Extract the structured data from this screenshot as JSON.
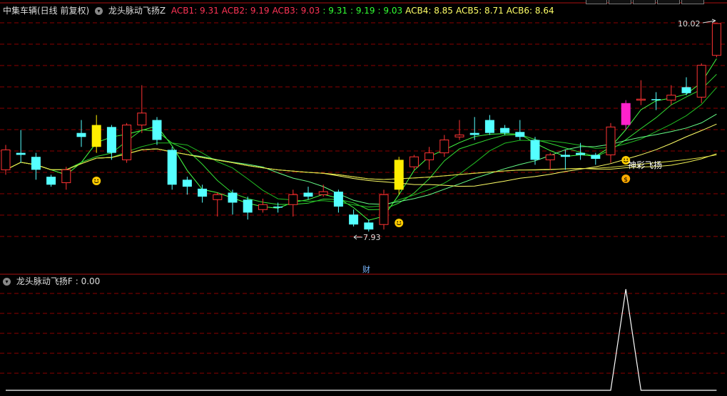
{
  "header": {
    "stock_name": "中集车辆(日线 前复权)",
    "indicator_name": "龙头脉动飞扬Z",
    "acb_lines": [
      {
        "label": "ACB1: 9.31",
        "color": "#ff3355"
      },
      {
        "label": "ACB2: 9.19",
        "color": "#ff3355"
      },
      {
        "label": "ACB3: 9.03",
        "color": "#ff3355"
      },
      {
        "label": ": 9.31",
        "color": "#33ff33"
      },
      {
        "label": ": 9.19",
        "color": "#33ff33"
      },
      {
        "label": ": 9.03",
        "color": "#33ff33"
      },
      {
        "label": "ACB4: 8.85",
        "color": "#ffff66"
      },
      {
        "label": "ACB5: 8.71",
        "color": "#ffff66"
      },
      {
        "label": "ACB6: 8.64",
        "color": "#ffff66"
      }
    ]
  },
  "price_labels": {
    "high": "10.02",
    "low": "7.93",
    "signal": "神彩飞扬"
  },
  "divider_label": "财",
  "sub_indicator": {
    "name": "龙头脉动飞扬F",
    "value": ": 0.00"
  },
  "colors": {
    "up": "#ff3333",
    "down": "#55ffff",
    "yellow": "#ffee00",
    "magenta": "#ff22cc",
    "grid": "#8b0000"
  },
  "chart_data": {
    "type": "candlestick",
    "candles": [
      {
        "o": 8.75,
        "c": 8.55,
        "h": 8.8,
        "l": 8.5,
        "t": "up"
      },
      {
        "o": 8.72,
        "c": 8.7,
        "h": 8.95,
        "l": 8.62,
        "t": "down"
      },
      {
        "o": 8.68,
        "c": 8.55,
        "h": 8.72,
        "l": 8.45,
        "t": "down"
      },
      {
        "o": 8.48,
        "c": 8.4,
        "h": 8.5,
        "l": 8.38,
        "t": "down"
      },
      {
        "o": 8.42,
        "c": 8.55,
        "h": 8.58,
        "l": 8.35,
        "t": "up"
      },
      {
        "o": 8.88,
        "c": 8.92,
        "h": 9.05,
        "l": 8.78,
        "t": "down"
      },
      {
        "o": 8.78,
        "c": 9.0,
        "h": 9.1,
        "l": 8.72,
        "t": "yellow"
      },
      {
        "o": 8.98,
        "c": 8.72,
        "h": 9.0,
        "l": 8.65,
        "t": "down"
      },
      {
        "o": 8.65,
        "c": 9.0,
        "h": 9.02,
        "l": 8.62,
        "t": "up"
      },
      {
        "o": 9.0,
        "c": 9.12,
        "h": 9.4,
        "l": 8.92,
        "t": "up"
      },
      {
        "o": 9.05,
        "c": 8.85,
        "h": 9.08,
        "l": 8.8,
        "t": "down"
      },
      {
        "o": 8.75,
        "c": 8.4,
        "h": 8.78,
        "l": 8.35,
        "t": "down"
      },
      {
        "o": 8.45,
        "c": 8.38,
        "h": 8.48,
        "l": 8.3,
        "t": "down"
      },
      {
        "o": 8.36,
        "c": 8.28,
        "h": 8.4,
        "l": 8.22,
        "t": "down"
      },
      {
        "o": 8.25,
        "c": 8.3,
        "h": 8.32,
        "l": 8.08,
        "t": "up"
      },
      {
        "o": 8.32,
        "c": 8.22,
        "h": 8.35,
        "l": 8.1,
        "t": "down"
      },
      {
        "o": 8.25,
        "c": 8.12,
        "h": 8.28,
        "l": 8.05,
        "t": "down"
      },
      {
        "o": 8.15,
        "c": 8.2,
        "h": 8.26,
        "l": 8.12,
        "t": "up"
      },
      {
        "o": 8.18,
        "c": 8.17,
        "h": 8.22,
        "l": 8.12,
        "t": "down"
      },
      {
        "o": 8.2,
        "c": 8.3,
        "h": 8.35,
        "l": 8.08,
        "t": "up"
      },
      {
        "o": 8.32,
        "c": 8.28,
        "h": 8.38,
        "l": 8.25,
        "t": "down"
      },
      {
        "o": 8.3,
        "c": 8.33,
        "h": 8.4,
        "l": 8.28,
        "t": "up"
      },
      {
        "o": 8.33,
        "c": 8.18,
        "h": 8.35,
        "l": 8.12,
        "t": "down"
      },
      {
        "o": 8.1,
        "c": 8.0,
        "h": 8.15,
        "l": 7.98,
        "t": "down"
      },
      {
        "o": 8.02,
        "c": 7.95,
        "h": 8.05,
        "l": 7.93,
        "t": "down"
      },
      {
        "o": 8.0,
        "c": 8.3,
        "h": 8.35,
        "l": 7.95,
        "t": "up"
      },
      {
        "o": 8.35,
        "c": 8.65,
        "h": 8.68,
        "l": 8.3,
        "t": "yellow"
      },
      {
        "o": 8.58,
        "c": 8.68,
        "h": 8.7,
        "l": 8.55,
        "t": "up"
      },
      {
        "o": 8.65,
        "c": 8.72,
        "h": 8.78,
        "l": 8.55,
        "t": "up"
      },
      {
        "o": 8.72,
        "c": 8.85,
        "h": 8.9,
        "l": 8.68,
        "t": "up"
      },
      {
        "o": 8.88,
        "c": 8.9,
        "h": 9.05,
        "l": 8.85,
        "t": "up"
      },
      {
        "o": 8.92,
        "c": 8.9,
        "h": 9.08,
        "l": 8.85,
        "t": "down"
      },
      {
        "o": 9.05,
        "c": 8.92,
        "h": 9.1,
        "l": 8.9,
        "t": "down"
      },
      {
        "o": 8.97,
        "c": 8.92,
        "h": 9.0,
        "l": 8.9,
        "t": "down"
      },
      {
        "o": 8.93,
        "c": 8.88,
        "h": 9.05,
        "l": 8.85,
        "t": "down"
      },
      {
        "o": 8.85,
        "c": 8.65,
        "h": 8.88,
        "l": 8.6,
        "t": "down"
      },
      {
        "o": 8.65,
        "c": 8.7,
        "h": 8.72,
        "l": 8.55,
        "t": "up"
      },
      {
        "o": 8.68,
        "c": 8.7,
        "h": 8.75,
        "l": 8.55,
        "t": "down"
      },
      {
        "o": 8.72,
        "c": 8.7,
        "h": 8.82,
        "l": 8.65,
        "t": "down"
      },
      {
        "o": 8.7,
        "c": 8.66,
        "h": 8.72,
        "l": 8.6,
        "t": "down"
      },
      {
        "o": 8.7,
        "c": 8.98,
        "h": 9.02,
        "l": 8.62,
        "t": "up"
      },
      {
        "o": 9.0,
        "c": 9.22,
        "h": 9.25,
        "l": 8.95,
        "t": "magenta"
      },
      {
        "o": 9.25,
        "c": 9.26,
        "h": 9.45,
        "l": 9.2,
        "t": "up"
      },
      {
        "o": 9.26,
        "c": 9.25,
        "h": 9.33,
        "l": 9.15,
        "t": "down"
      },
      {
        "o": 9.25,
        "c": 9.3,
        "h": 9.4,
        "l": 9.2,
        "t": "up"
      },
      {
        "o": 9.32,
        "c": 9.38,
        "h": 9.48,
        "l": 9.3,
        "t": "down"
      },
      {
        "o": 9.28,
        "c": 9.6,
        "h": 9.62,
        "l": 9.22,
        "t": "up"
      },
      {
        "o": 9.7,
        "c": 10.02,
        "h": 10.02,
        "l": 9.68,
        "t": "up"
      }
    ],
    "sub_series": [
      0,
      0,
      0,
      0,
      0,
      0,
      0,
      0,
      0,
      0,
      0,
      0,
      0,
      0,
      0,
      0,
      0,
      0,
      0,
      0,
      0,
      0,
      0,
      0,
      0,
      0,
      0,
      0,
      0,
      0,
      0,
      0,
      0,
      0,
      0,
      0,
      0,
      0,
      0,
      0,
      0,
      1,
      0,
      0,
      0,
      0,
      0,
      0
    ]
  }
}
